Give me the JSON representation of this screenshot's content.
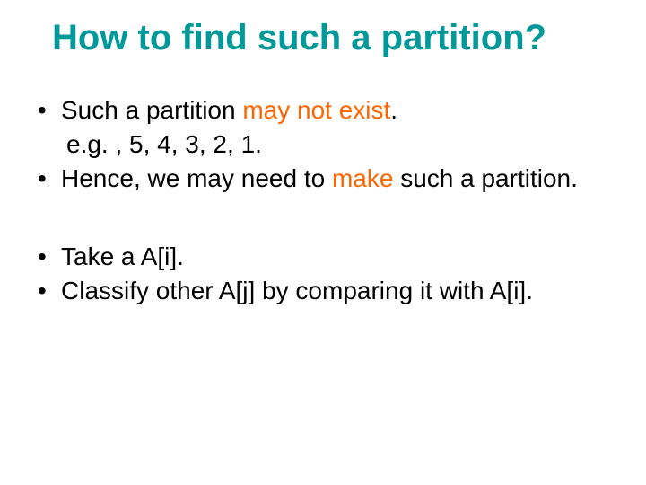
{
  "title": "How to find such a partition?",
  "block1": {
    "b1_pre": "Such a partition ",
    "b1_hl": "may not exist",
    "b1_post": ".",
    "example": "e.g. , 5, 4, 3, 2, 1.",
    "b2_pre": "Hence, we may need to ",
    "b2_hl": "make",
    "b2_post": " such a partition."
  },
  "block2": {
    "b3": "Take a A[i].",
    "b4": "Classify other A[j] by comparing it with A[i]."
  },
  "bullet": "•"
}
